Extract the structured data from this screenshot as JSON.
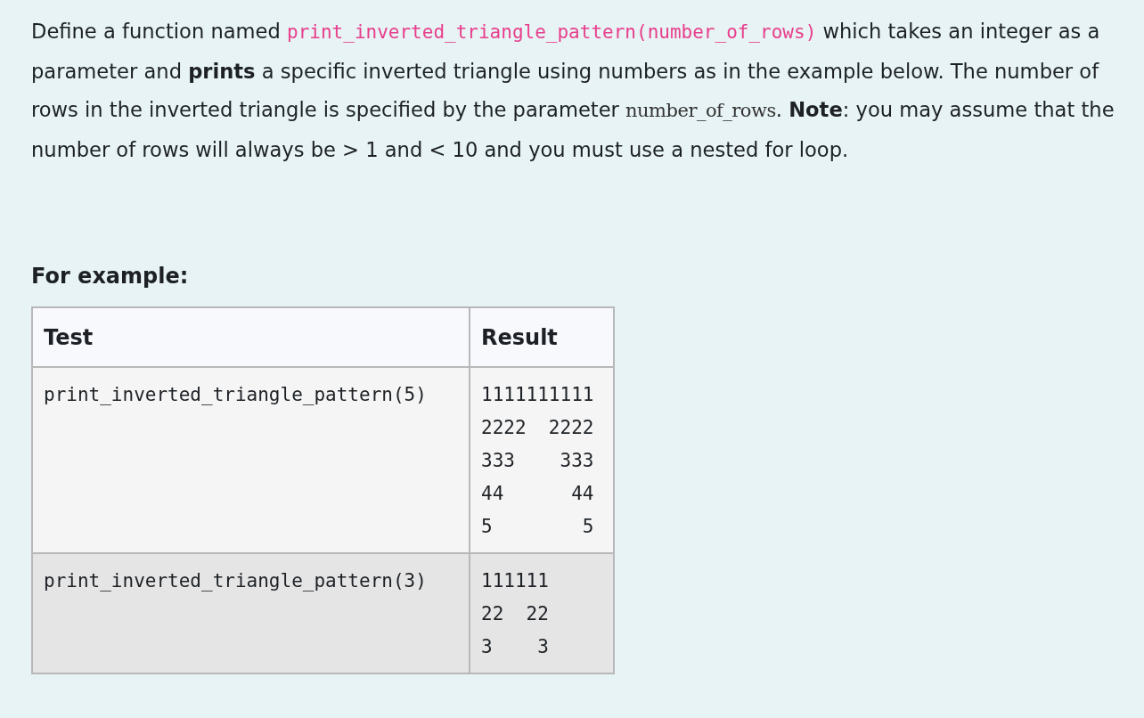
{
  "question": {
    "segments": [
      {
        "kind": "text",
        "text": "Define a function named "
      },
      {
        "kind": "code",
        "text": "print_inverted_triangle_pattern(number_of_rows)"
      },
      {
        "kind": "text",
        "text": " which takes an integer as a parameter and **prints** a specific inverted triangle using numbers as in the example below. The number of rows in the inverted triangle is specified by the parameter "
      },
      {
        "kind": "var",
        "text": "number_of_rows"
      },
      {
        "kind": "text",
        "text": ". **Note**: you may assume that the number of rows will always be > 1 and < 10 and you must use a nested for loop."
      }
    ]
  },
  "example_heading": "For example:",
  "table": {
    "columns": [
      "Test",
      "Result"
    ],
    "rows": [
      {
        "test": "print_inverted_triangle_pattern(5)",
        "result": [
          "1111111111",
          "2222  2222",
          "333    333",
          "44      44",
          "5        5"
        ]
      },
      {
        "test": "print_inverted_triangle_pattern(3)",
        "result": [
          "111111",
          "22  22",
          "3    3"
        ]
      }
    ]
  }
}
